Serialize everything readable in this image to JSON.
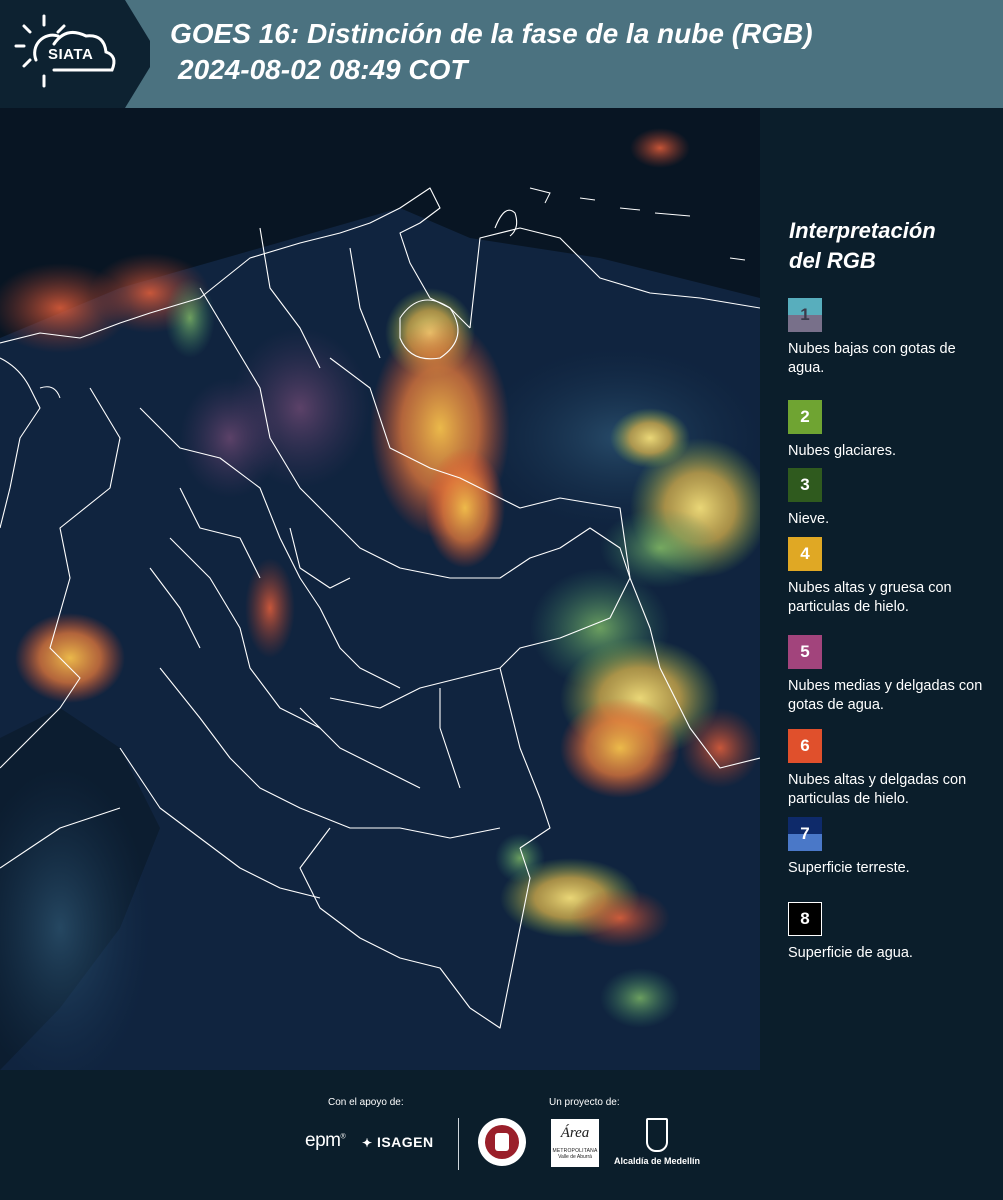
{
  "header": {
    "logo_text": "SIATA",
    "title_line1": "GOES 16: Distinción de la fase de la nube (RGB)",
    "title_line2": "2024-08-02 08:49 COT"
  },
  "legend": {
    "title_line1": "Interpretación",
    "title_line2": "del RGB",
    "items": [
      {
        "number": "1",
        "label": "Nubes bajas con gotas de agua.",
        "color_top": "#58aebd",
        "color_bottom": "#78708a"
      },
      {
        "number": "2",
        "label": "Nubes glaciares.",
        "color_top": "#6fa432",
        "color_bottom": "#6fa432"
      },
      {
        "number": "3",
        "label": "Nieve.",
        "color_top": "#2f5a1e",
        "color_bottom": "#2f5a1e"
      },
      {
        "number": "4",
        "label": "Nubes altas y gruesa con particulas de hielo.",
        "color_top": "#e0a824",
        "color_bottom": "#e0a824"
      },
      {
        "number": "5",
        "label": "Nubes medias y delgadas con gotas de agua.",
        "color_top": "#a2447c",
        "color_bottom": "#a2447c"
      },
      {
        "number": "6",
        "label": "Nubes altas y delgadas con particulas de hielo.",
        "color_top": "#e0502c",
        "color_bottom": "#e0502c"
      },
      {
        "number": "7",
        "label": "Superficie terreste.",
        "color_top": "#0e2a6a",
        "color_bottom": "#4a78c8"
      },
      {
        "number": "8",
        "label": "Superficie de agua.",
        "color_top": "#000000",
        "color_bottom": "#000000"
      }
    ]
  },
  "footer": {
    "support_label": "Con el apoyo de:",
    "project_label": "Un proyecto de:",
    "sponsor1": "epm",
    "sponsor2": "ISAGEN",
    "partner1": "Área",
    "partner1_sub": "METROPOLITANA",
    "partner1_sub2": "Valle de Aburrá",
    "partner2": "Alcaldía de Medellín"
  },
  "colors": {
    "header_bg": "#4b7280",
    "panel_bg": "#0b1e2b"
  }
}
